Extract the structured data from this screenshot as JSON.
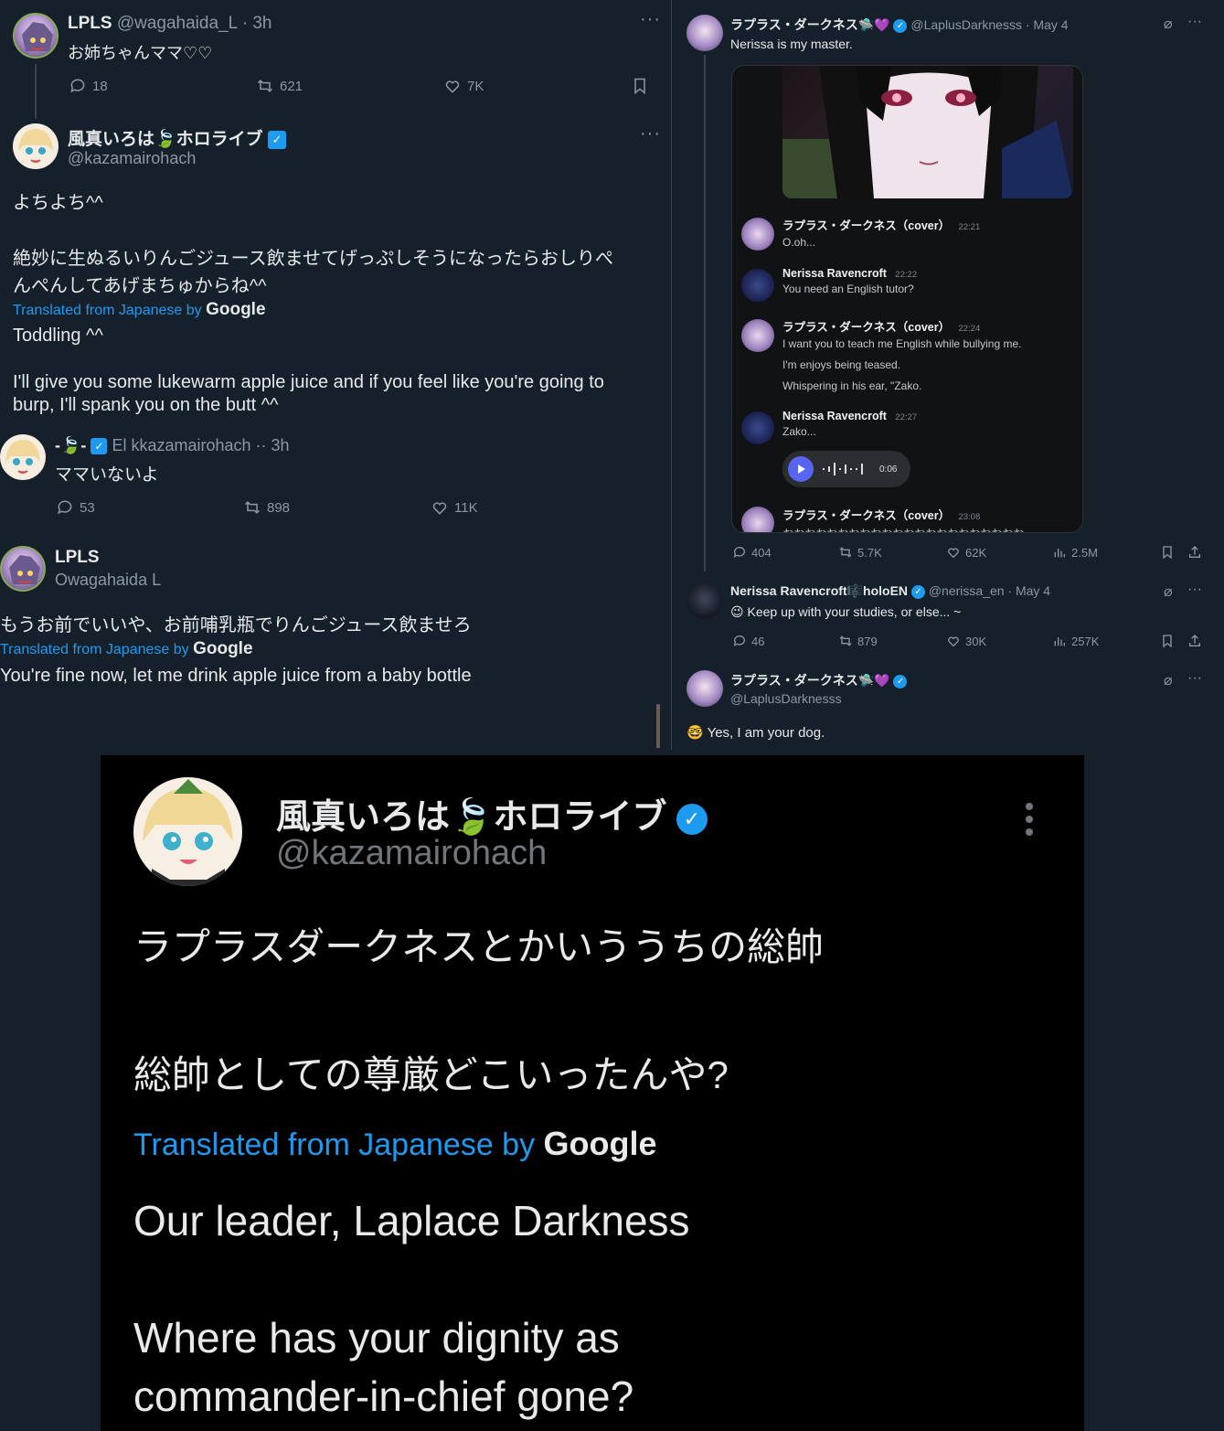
{
  "left": {
    "tweet1": {
      "name": "LPLS",
      "handle": "@wagahaida_L · 3h",
      "text": "お姉ちゃんママ♡♡",
      "replies": "18",
      "retweets": "621",
      "likes": "7K"
    },
    "tweet2": {
      "name": "風真いろは🍃ホロライブ",
      "handle": "@kazamairohach",
      "text_line1": "よちよち^^",
      "text_line2": "絶妙に生ぬるいりんごジュース飲ませてげっぷしそうになったらおしりぺ",
      "text_line3": "んぺんしてあげまちゅからね^^",
      "translated_label": "Translated from Japanese by",
      "google": "Google",
      "translation_line1": "Toddling ^^",
      "translation_line2": "I'll give you some lukewarm apple juice and if you feel like you're going to",
      "translation_line3": "burp, I'll spank you on the butt ^^"
    },
    "tweet3": {
      "name": "-🍃-",
      "handle": "El kkazamairohach ·· 3h",
      "text": "ママいないよ",
      "replies": "53",
      "retweets": "898",
      "likes": "11K"
    },
    "tweet4": {
      "name": "LPLS",
      "handle": "Owagahaida L",
      "text": "もうお前でいいや、お前哺乳瓶でりんごジュース飲ませろ",
      "translated_label": "Translated from Japanese by",
      "google": "Google",
      "translation": "You're fine now, let me drink apple juice from a baby bottle"
    }
  },
  "right": {
    "tweet1": {
      "name": "ラプラス・ダークネス🛸💜",
      "handle": "@LaplusDarknesss · May 4",
      "text": "Nerissa is my master.",
      "replies": "404",
      "retweets": "5.7K",
      "likes": "62K",
      "views": "2.5M"
    },
    "discord": {
      "messages": [
        {
          "name": "ラプラス・ダークネス（cover）",
          "time": "22:21",
          "lines": [
            "O.oh..."
          ]
        },
        {
          "name": "Nerissa Ravencroft",
          "time": "22:22",
          "lines": [
            "You need an English tutor?"
          ]
        },
        {
          "name": "ラプラス・ダークネス（cover）",
          "time": "22:24",
          "lines": [
            "I want you to teach me English while bullying me.",
            "I'm enjoys being teased.",
            "Whispering in his ear, \"Zako."
          ]
        },
        {
          "name": "Nerissa Ravencroft",
          "time": "22:27",
          "lines": [
            "Zako..."
          ]
        },
        {
          "name": "ラプラス・ダークネス（cover）",
          "time": "23:08",
          "lines": [
            "おおおおおおおおおおおおおおおおおおおおおお"
          ]
        }
      ],
      "voice_duration": "0:06"
    },
    "tweet2": {
      "name": "Nerissa Ravencroft🎼holoEN",
      "handle": "@nerissa_en · May 4",
      "text": "😉 Keep up with your studies, or else... ~",
      "replies": "46",
      "retweets": "879",
      "likes": "30K",
      "views": "257K"
    },
    "tweet3": {
      "name": "ラプラス・ダークネス🛸💜",
      "handle": "@LaplusDarknesss",
      "text": "🤓 Yes, I am your dog."
    }
  },
  "bottom": {
    "name": "風真いろは🍃ホロライブ",
    "handle": "@kazamairohach",
    "text_line1": "ラプラスダークネスとかいううちの総帥",
    "text_line2": "総帥としての尊厳どこいったんや?",
    "translated_label": "Translated from Japanese by",
    "google": "Google",
    "translation_line1": "Our leader, Laplace Darkness",
    "translation_line2": "Where has your dignity as",
    "translation_line3": "commander-in-chief gone?"
  },
  "icons": [
    "reply-icon",
    "retweet-icon",
    "like-icon",
    "bookmark-icon",
    "views-icon",
    "share-icon",
    "more-icon",
    "grok-icon",
    "verified-icon",
    "play-icon"
  ],
  "colors": {
    "background": "#15202b",
    "text": "#e7e9ea",
    "muted": "#8b98a5",
    "accent": "#1d9bf0",
    "bottom_bg": "#000000"
  }
}
